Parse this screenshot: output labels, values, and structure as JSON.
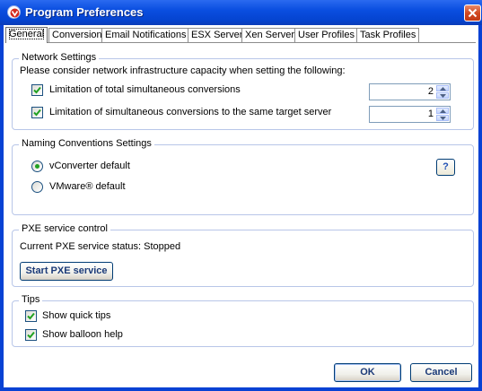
{
  "window": {
    "title": "Program Preferences",
    "title_color": "#ffffff",
    "titlebar_color": "#0a4ee0"
  },
  "tabs": [
    {
      "label": "General",
      "active": true
    },
    {
      "label": "Conversion",
      "active": false
    },
    {
      "label": "Email Notifications",
      "active": false
    },
    {
      "label": "ESX Server",
      "active": false
    },
    {
      "label": "Xen Server",
      "active": false
    },
    {
      "label": "User Profiles",
      "active": false
    },
    {
      "label": "Task Profiles",
      "active": false
    }
  ],
  "network": {
    "title": "Network Settings",
    "description": "Please consider network infrastructure capacity when setting the following:",
    "total_limit": {
      "label": "Limitation of total simultaneous conversions",
      "checked": true,
      "value": "2"
    },
    "target_limit": {
      "label": "Limitation of simultaneous conversions to the same target server",
      "checked": true,
      "value": "1"
    }
  },
  "naming": {
    "title": "Naming Conventions Settings",
    "options": [
      {
        "label": "vConverter default",
        "selected": true
      },
      {
        "label": "VMware® default",
        "selected": false
      }
    ],
    "help_label": "?"
  },
  "pxe": {
    "title": "PXE service control",
    "status_text": "Current PXE service status: Stopped",
    "start_label": "Start PXE service"
  },
  "tips": {
    "title": "Tips",
    "quick_tips": {
      "label": "Show quick tips",
      "checked": true
    },
    "balloon_help": {
      "label": "Show balloon help",
      "checked": true
    }
  },
  "footer": {
    "ok_label": "OK",
    "cancel_label": "Cancel"
  },
  "colors": {
    "group_border": "#b8c6e8",
    "check_mark": "#21a121",
    "button_text": "#1b3a78"
  }
}
